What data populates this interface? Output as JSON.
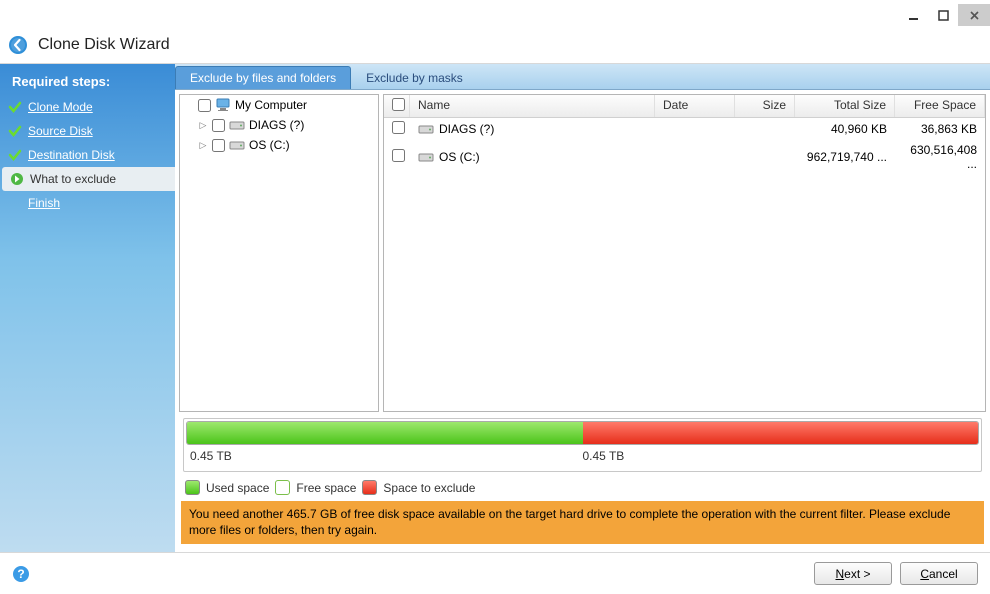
{
  "window": {
    "title": "Clone Disk Wizard"
  },
  "sidebar": {
    "heading": "Required steps:",
    "steps": [
      {
        "label": "Clone Mode",
        "done": true
      },
      {
        "label": "Source Disk",
        "done": true
      },
      {
        "label": "Destination Disk",
        "done": true
      },
      {
        "label": "What to exclude",
        "active": true
      },
      {
        "label": "Finish",
        "indent": true
      }
    ]
  },
  "tabs": {
    "active": "Exclude by files and folders",
    "other": "Exclude by masks"
  },
  "tree": {
    "root": "My Computer",
    "children": [
      {
        "label": "DIAGS (?)"
      },
      {
        "label": "OS (C:)"
      }
    ]
  },
  "list": {
    "columns": {
      "name": "Name",
      "date": "Date",
      "size": "Size",
      "total": "Total Size",
      "free": "Free Space"
    },
    "rows": [
      {
        "name": "DIAGS (?)",
        "date": "",
        "size": "",
        "total": "40,960 KB",
        "free": "36,863 KB"
      },
      {
        "name": "OS (C:)",
        "date": "",
        "size": "",
        "total": "962,719,740 ...",
        "free": "630,516,408 ..."
      }
    ]
  },
  "capacity": {
    "used_label": "0.45 TB",
    "exclude_label": "0.45 TB",
    "used_pct": 50
  },
  "legend": {
    "used": "Used space",
    "free": "Free space",
    "exclude": "Space to exclude"
  },
  "warning": "You need another 465.7 GB of free disk space available on the target hard drive to complete the operation with the current filter. Please exclude more files or folders, then try again.",
  "buttons": {
    "next": "ext >",
    "next_ul": "N",
    "cancel": "ancel",
    "cancel_ul": "C"
  }
}
